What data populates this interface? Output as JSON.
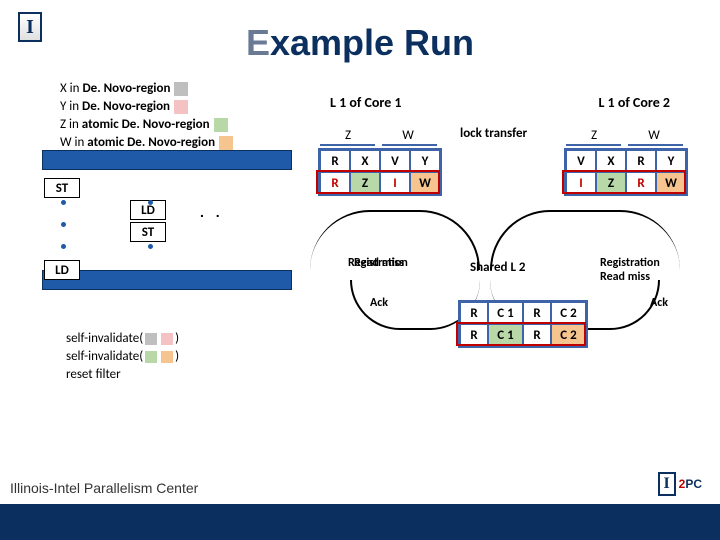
{
  "title": "Example Run",
  "title_init": "E",
  "title_rest": "xample Run",
  "legend": {
    "items": [
      {
        "pre": "X in ",
        "bold": "De. Novo-region",
        "color": "grey"
      },
      {
        "pre": "Y in ",
        "bold": "De. Novo-region",
        "color": "pink"
      },
      {
        "pre": "Z in ",
        "bold": "atomic De. Novo-region",
        "color": "green"
      },
      {
        "pre": "W in ",
        "bold": "atomic De. Novo-region",
        "color": "orange"
      }
    ]
  },
  "core1_label": "L 1 of Core 1",
  "core2_label": "L 1 of Core 2",
  "lock_transfer": "lock transfer",
  "cache_cols": {
    "z": "Z",
    "w": "W"
  },
  "cache1": {
    "row1": [
      "R",
      "X",
      "V",
      "Y"
    ],
    "row2": [
      "R",
      "Z",
      "I",
      "W"
    ]
  },
  "cache2": {
    "row1": [
      "V",
      "X",
      "R",
      "Y"
    ],
    "row2": [
      "I",
      "Z",
      "R",
      "W"
    ]
  },
  "inst": {
    "st": "ST",
    "ld": "LD"
  },
  "ellipsis": ". .",
  "mid": {
    "reg1": "Registration\nRead miss",
    "reg2": "Registration\nRead miss",
    "shared_l2": "Shared L 2",
    "ack": "Ack"
  },
  "l2": {
    "row1": [
      "R",
      "C 1",
      "R",
      "C 2"
    ],
    "row2": [
      "R",
      "C 1",
      "R",
      "C 2"
    ]
  },
  "selfinv": {
    "line1_text": "self-invalidate(",
    "close_paren": ")",
    "line2_text": "self-invalidate(",
    "line3_text": "reset filter"
  },
  "footer": {
    "center": "Illinois-Intel Parallelism Center",
    "i2pc_i": "I",
    "i2pc_2": "2",
    "i2pc_pc": "PC"
  }
}
